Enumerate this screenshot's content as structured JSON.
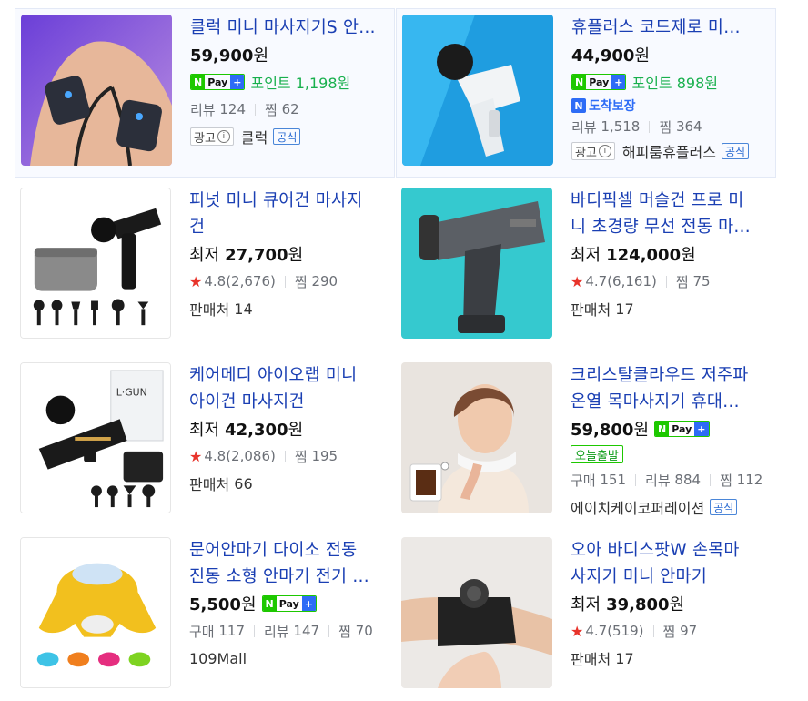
{
  "products": [
    {
      "title": "클럭 미니 마사지기S 안…",
      "price": "59,900",
      "won": "원",
      "npay": {
        "n": "N",
        "pay": "Pay",
        "plus": "+"
      },
      "point_label": "포인트",
      "point_value": "1,198원",
      "review_label": "리뷰",
      "review_count": "124",
      "zzim_label": "찜",
      "zzim_count": "62",
      "ad_label": "광고",
      "info_icon": "i",
      "seller": "클럭",
      "official": "공식"
    },
    {
      "title": "휴플러스 코드제로 미…",
      "price": "44,900",
      "won": "원",
      "npay": {
        "n": "N",
        "pay": "Pay",
        "plus": "+"
      },
      "point_label": "포인트",
      "point_value": "898원",
      "arrival_n": "N",
      "arrival_label": "도착보장",
      "review_label": "리뷰",
      "review_count": "1,518",
      "zzim_label": "찜",
      "zzim_count": "364",
      "ad_label": "광고",
      "info_icon": "i",
      "seller": "해피룸휴플러스",
      "official": "공식"
    },
    {
      "title_line1": "피넛 미니 큐어건 마사지",
      "title_line2": "건",
      "low_label": "최저",
      "price": "27,700",
      "won": "원",
      "star": "★",
      "rating": "4.8(2,676)",
      "zzim_label": "찜",
      "zzim_count": "290",
      "sellers_label": "판매처",
      "sellers_count": "14"
    },
    {
      "title_line1": "바디픽셀 머슬건 프로 미",
      "title_line2": "니 초경량 무선 전동 마…",
      "low_label": "최저",
      "price": "124,000",
      "won": "원",
      "star": "★",
      "rating": "4.7(6,161)",
      "zzim_label": "찜",
      "zzim_count": "75",
      "sellers_label": "판매처",
      "sellers_count": "17"
    },
    {
      "title_line1": "케어메디 아이오랩 미니",
      "title_line2": "아이건 마사지건",
      "low_label": "최저",
      "price": "42,300",
      "won": "원",
      "star": "★",
      "rating": "4.8(2,086)",
      "zzim_label": "찜",
      "zzim_count": "195",
      "sellers_label": "판매처",
      "sellers_count": "66",
      "image_text": "L·GUN"
    },
    {
      "title_line1": "크리스탈클라우드 저주파",
      "title_line2": "온열 목마사지기 휴대…",
      "price": "59,800",
      "won": "원",
      "npay": {
        "n": "N",
        "pay": "Pay",
        "plus": "+"
      },
      "today_label": "오늘출발",
      "buy_label": "구매",
      "buy_count": "151",
      "review_label": "리뷰",
      "review_count": "884",
      "zzim_label": "찜",
      "zzim_count": "112",
      "seller": "에이치케이코퍼레이션",
      "official": "공식"
    },
    {
      "title_line1": "문어안마기 다이소 전동",
      "title_line2": "진동 소형 안마기 전기 …",
      "price": "5,500",
      "won": "원",
      "npay": {
        "n": "N",
        "pay": "Pay",
        "plus": "+"
      },
      "buy_label": "구매",
      "buy_count": "117",
      "review_label": "리뷰",
      "review_count": "147",
      "zzim_label": "찜",
      "zzim_count": "70",
      "seller": "109Mall"
    },
    {
      "title_line1": "오아 바디스팟W 손목마",
      "title_line2": "사지기 미니 안마기",
      "low_label": "최저",
      "price": "39,800",
      "won": "원",
      "star": "★",
      "rating": "4.7(519)",
      "zzim_label": "찜",
      "zzim_count": "97",
      "sellers_label": "판매처",
      "sellers_count": "17"
    }
  ],
  "colors": {
    "title_link": "#1a3fb3",
    "npay_green": "#1ec800",
    "point_green": "#18b04d",
    "star_red": "#e8332a",
    "official_blue": "#2a6bd2",
    "ad_bg": "#f8faff"
  }
}
